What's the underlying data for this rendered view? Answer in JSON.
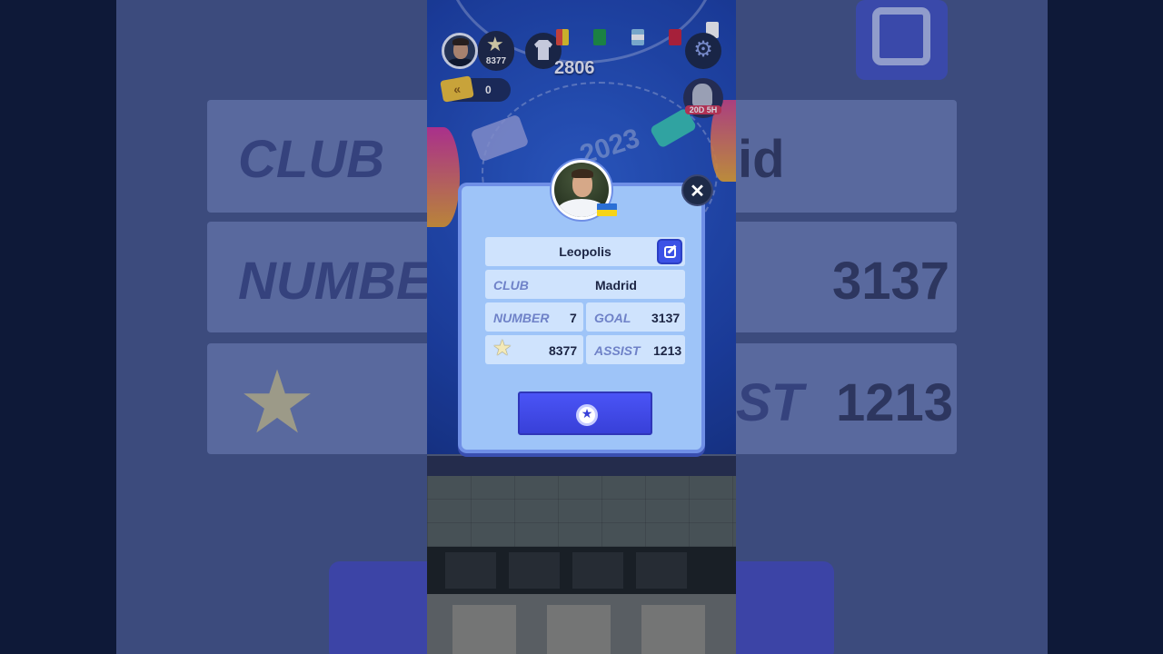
{
  "hud": {
    "stars": "8377",
    "rating": "2806",
    "tickets": "0",
    "timer": "20D 5H"
  },
  "profile": {
    "name": "Leopolis",
    "club_label": "CLUB",
    "club_value": "Madrid",
    "number_label": "NUMBER",
    "number_value": "7",
    "goal_label": "GOAL",
    "goal_value": "3137",
    "stars_value": "8377",
    "assist_label": "ASSIST",
    "assist_value": "1213",
    "nationality_flag": "ukraine-flag"
  },
  "background_blur": {
    "club_label": "CLUB",
    "club_value_partial": "id",
    "number_label": "NUMBER",
    "goal_value": "3137",
    "assist_label_partial": "ST",
    "assist_value": "1213"
  },
  "colors": {
    "modal_bg": "#9ec4f8",
    "cell_bg": "#cfe3fd",
    "accent_blue": "#3c52e6",
    "label_color": "#6f82c8"
  },
  "icons": {
    "edit": "edit-icon",
    "close": "close-icon",
    "reward": "medal-icon",
    "star": "star-icon",
    "settings": "gear-icon",
    "shirt": "shirt-icon",
    "ticket": "ticket-icon"
  }
}
